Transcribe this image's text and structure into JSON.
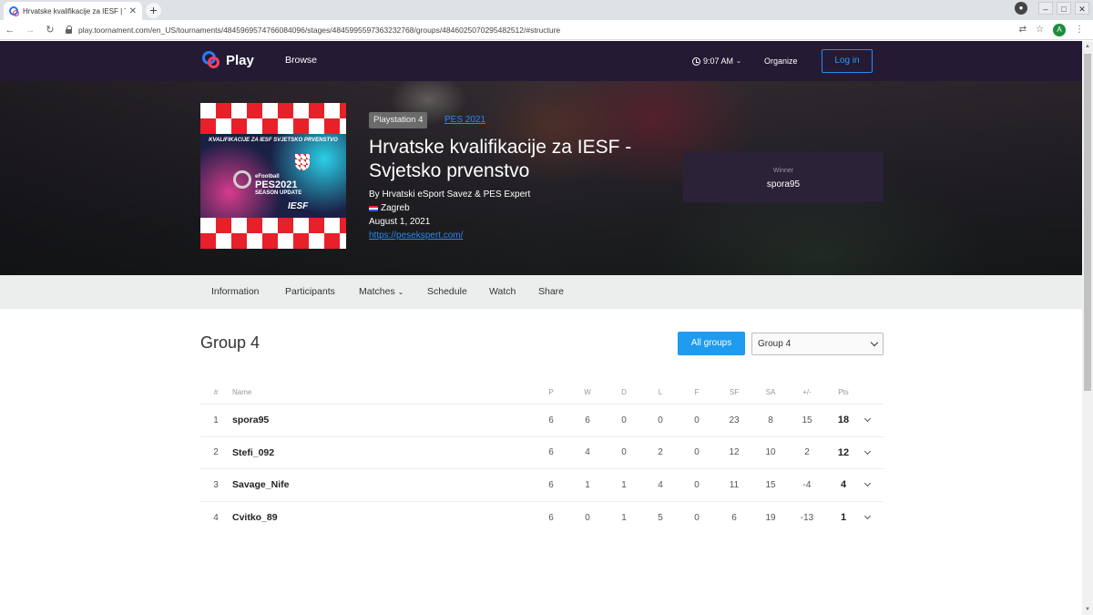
{
  "browser": {
    "tab_title": "Hrvatske kvalifikacije za IESF | To...",
    "tab_close": "✕",
    "new_tab": "+",
    "url": "play.toornament.com/en_US/tournaments/4845969574766084096/stages/4845995597363232768/groups/4846025070295482512/#structure",
    "profile_initial": "A"
  },
  "site_nav": {
    "logo_text": "Play",
    "browse": "Browse",
    "time": "9:07 AM",
    "organize": "Organize",
    "login": "Log in"
  },
  "tournament": {
    "platform": "Playstation 4",
    "game": "PES 2021",
    "title": "Hrvatske kvalifikacije za IESF - Svjetsko prvenstvo",
    "organizer": "By Hrvatski eSport Savez & PES Expert",
    "location": "Zagreb",
    "date": "August 1, 2021",
    "website": "https://pesekspert.com/",
    "cover": {
      "caption": "KVALIFIKACIJE ZA IESF SVJETSKO PRVENSTVO",
      "brand": "eFootball",
      "game": "PES2021",
      "edition": "SEASON UPDATE",
      "partner": "IESF"
    },
    "winner_label": "Winner",
    "winner_name": "spora95"
  },
  "subnav": [
    "Information",
    "Participants",
    "Matches",
    "Schedule",
    "Watch",
    "Share"
  ],
  "group": {
    "title": "Group 4",
    "all_groups": "All groups",
    "selected_group": "Group 4"
  },
  "standings": {
    "headers": [
      "#",
      "Name",
      "P",
      "W",
      "D",
      "L",
      "F",
      "SF",
      "SA",
      "+/-",
      "Pts"
    ],
    "rows": [
      {
        "rank": "1",
        "name": "spora95",
        "p": "6",
        "w": "6",
        "d": "0",
        "l": "0",
        "f": "0",
        "sf": "23",
        "sa": "8",
        "diff": "15",
        "pts": "18"
      },
      {
        "rank": "2",
        "name": "Stefi_092",
        "p": "6",
        "w": "4",
        "d": "0",
        "l": "2",
        "f": "0",
        "sf": "12",
        "sa": "10",
        "diff": "2",
        "pts": "12"
      },
      {
        "rank": "3",
        "name": "Savage_Nife",
        "p": "6",
        "w": "1",
        "d": "1",
        "l": "4",
        "f": "0",
        "sf": "11",
        "sa": "15",
        "diff": "-4",
        "pts": "4"
      },
      {
        "rank": "4",
        "name": "Cvitko_89",
        "p": "6",
        "w": "0",
        "d": "1",
        "l": "5",
        "f": "0",
        "sf": "6",
        "sa": "19",
        "diff": "-13",
        "pts": "1"
      }
    ]
  },
  "colors": {
    "nav_bg": "#241a34",
    "accent_blue": "#1f9bf0",
    "logo_red": "#ff3d5a",
    "link_blue": "#2e86f0"
  }
}
